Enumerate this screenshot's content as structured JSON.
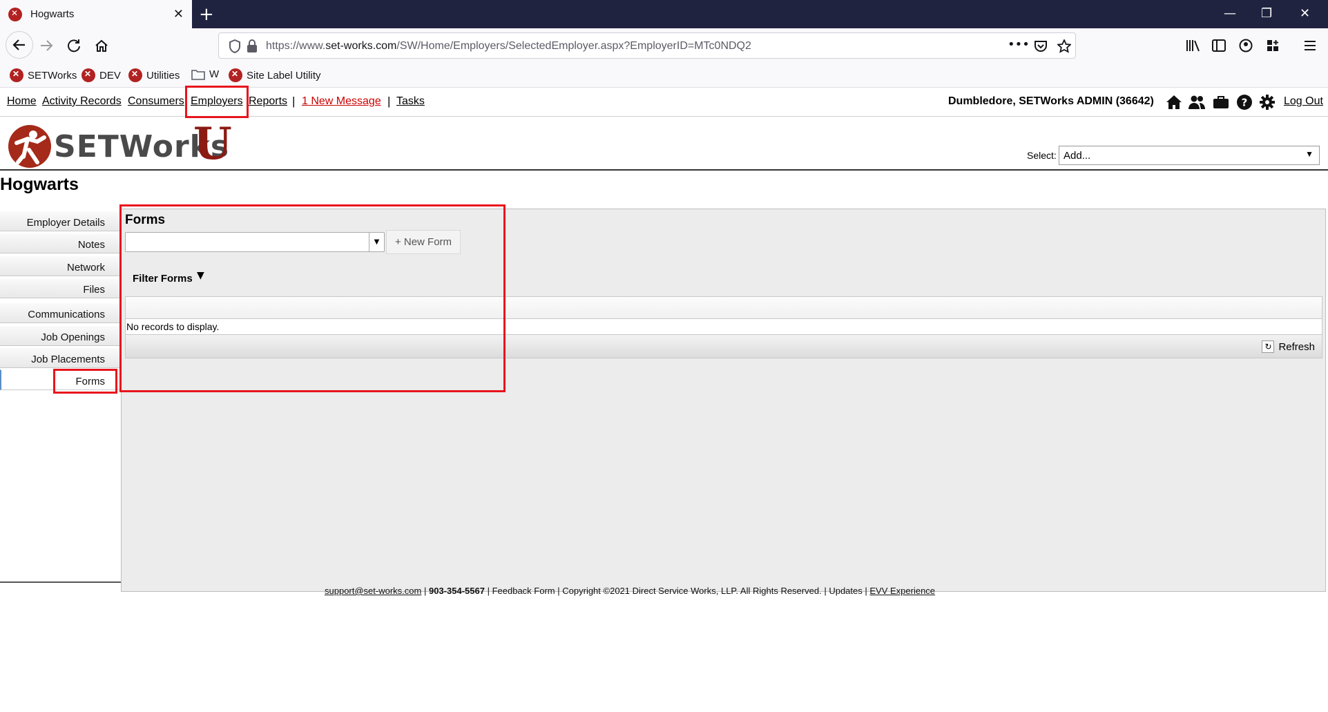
{
  "browser": {
    "tab_title": "Hogwarts",
    "url_prefix": "https://www.",
    "url_domain": "set-works.com",
    "url_path": "/SW/Home/Employers/SelectedEmployer.aspx?EmployerID=MTc0NDQ2",
    "bookmarks": [
      "SETWorks",
      "DEV",
      "Utilities",
      "W",
      "Site Label Utility"
    ]
  },
  "topmenu": {
    "home": "Home",
    "activity_records": "Activity Records",
    "consumers": "Consumers",
    "employers": "Employers",
    "reports": "Reports",
    "sep": "|",
    "new_message": "1 New Message",
    "tasks": "Tasks",
    "user": "Dumbledore, SETWorks ADMIN  (36642)",
    "logout": "Log Out"
  },
  "header": {
    "logo_text": "SETWorks",
    "logo_u": "U",
    "select_label": "Select:",
    "select_value": "Add..."
  },
  "page_title": "Hogwarts",
  "sidebar": {
    "items": [
      "Employer Details",
      "Notes",
      "Network",
      "Files",
      "Communications",
      "Job Openings",
      "Job Placements",
      "Forms"
    ]
  },
  "main": {
    "title": "Forms",
    "new_form": "+ New Form",
    "filter_forms": "Filter Forms",
    "no_records": "No records to display.",
    "refresh": "Refresh"
  },
  "footer": {
    "email": "support@set-works.com",
    "phone": "903-354-5567",
    "feedback": "Feedback Form",
    "copyright": "Copyright ©2021 Direct Service Works, LLP. All Rights Reserved.",
    "updates": "Updates",
    "evv": "EVV Experience"
  },
  "colors": {
    "brand_red": "#a52a1a",
    "highlight": "#e8141c",
    "titlebar": "#202340"
  }
}
